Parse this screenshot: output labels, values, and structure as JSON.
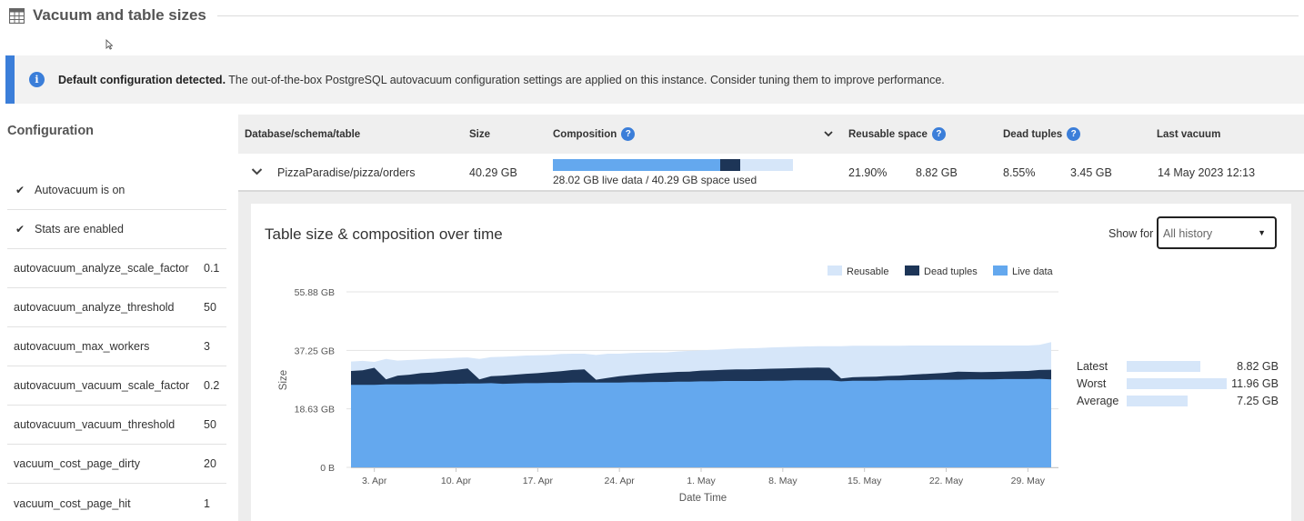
{
  "header": {
    "title": "Vacuum and table sizes",
    "icon": "table-grid-icon"
  },
  "alert": {
    "icon": "info-icon",
    "bold": "Default configuration detected.",
    "text": " The out-of-the-box PostgreSQL autovacuum configuration settings are applied on this instance. Consider tuning them to improve performance."
  },
  "config": {
    "title": "Configuration",
    "checks": [
      {
        "label": "Autovacuum is on",
        "icon": "check-icon"
      },
      {
        "label": "Stats are enabled",
        "icon": "check-icon"
      }
    ],
    "settings": [
      {
        "key": "autovacuum_analyze_scale_factor",
        "value": "0.1"
      },
      {
        "key": "autovacuum_analyze_threshold",
        "value": "50"
      },
      {
        "key": "autovacuum_max_workers",
        "value": "3"
      },
      {
        "key": "autovacuum_vacuum_scale_factor",
        "value": "0.2"
      },
      {
        "key": "autovacuum_vacuum_threshold",
        "value": "50"
      },
      {
        "key": "vacuum_cost_page_dirty",
        "value": "20"
      },
      {
        "key": "vacuum_cost_page_hit",
        "value": "1"
      }
    ]
  },
  "table": {
    "headers": {
      "name": "Database/schema/table",
      "size": "Size",
      "composition": "Composition",
      "reusable": "Reusable space",
      "dead": "Dead tuples",
      "last_vacuum": "Last vacuum"
    },
    "row": {
      "name": "PizzaParadise/pizza/orders",
      "size": "40.29 GB",
      "composition_caption": "28.02 GB live data / 40.29 GB space used",
      "composition_fractions": {
        "live": 0.696,
        "dead": 0.086,
        "reusable": 0.218
      },
      "reusable_pct": "21.90%",
      "reusable_size": "8.82 GB",
      "dead_pct": "8.55%",
      "dead_size": "3.45 GB",
      "last_vacuum": "14 May 2023 12:13"
    }
  },
  "detail": {
    "title": "Table size & composition over time",
    "show_for_label": "Show for",
    "show_for_value": "All history"
  },
  "colors": {
    "live": "#64a8ee",
    "dead": "#1d3557",
    "reusable": "#d6e6f9",
    "accent": "#3b7ed9"
  },
  "chart_data": {
    "type": "area",
    "xlabel": "Date Time",
    "ylabel": "Size",
    "y_ticks": [
      "0 B",
      "18.63 GB",
      "37.25 GB",
      "55.88 GB"
    ],
    "ylim": [
      0,
      55.88
    ],
    "x_ticks": [
      "3. Apr",
      "10. Apr",
      "17. Apr",
      "24. Apr",
      "1. May",
      "8. May",
      "15. May",
      "22. May",
      "29. May"
    ],
    "x_days": [
      1,
      2,
      3,
      4,
      5,
      6,
      7,
      8,
      9,
      10,
      11,
      12,
      13,
      14,
      15,
      16,
      17,
      18,
      19,
      20,
      21,
      22,
      23,
      24,
      25,
      26,
      27,
      28,
      29,
      30,
      31,
      32,
      33,
      34,
      35,
      36,
      37,
      38,
      39,
      40,
      41,
      42,
      43,
      44,
      45,
      46,
      47,
      48,
      49,
      50,
      51,
      52,
      53,
      54,
      55,
      56,
      57,
      58,
      59,
      60,
      61
    ],
    "legend": [
      "Reusable",
      "Dead tuples",
      "Live data"
    ],
    "legend_position": "top-right",
    "series": [
      {
        "name": "Live data",
        "values": [
          26.3,
          26.3,
          26.3,
          26.4,
          26.4,
          26.4,
          26.5,
          26.5,
          26.6,
          26.6,
          26.7,
          26.7,
          26.8,
          26.6,
          26.7,
          26.8,
          26.8,
          26.9,
          26.9,
          27.0,
          27.0,
          27.0,
          27.0,
          27.0,
          27.1,
          27.1,
          27.2,
          27.2,
          27.3,
          27.3,
          27.4,
          27.4,
          27.5,
          27.5,
          27.5,
          27.5,
          27.6,
          27.6,
          27.7,
          27.7,
          27.7,
          27.7,
          27.4,
          27.6,
          27.6,
          27.6,
          27.7,
          27.7,
          27.8,
          27.8,
          27.9,
          27.9,
          27.9,
          28.0,
          28.0,
          28.0,
          28.1,
          28.1,
          28.1,
          28.2,
          28.0
        ]
      },
      {
        "name": "Dead tuples",
        "values": [
          4.4,
          4.6,
          5.4,
          1.6,
          2.8,
          3.1,
          3.5,
          3.7,
          4.0,
          4.4,
          4.8,
          1.3,
          2.2,
          2.6,
          2.8,
          3.0,
          3.2,
          3.4,
          3.7,
          4.0,
          4.2,
          0.9,
          1.5,
          2.0,
          2.3,
          2.6,
          2.8,
          3.0,
          3.1,
          3.2,
          3.4,
          3.5,
          3.6,
          3.7,
          3.7,
          3.8,
          3.8,
          3.9,
          3.9,
          4.0,
          4.1,
          4.0,
          0.9,
          1.1,
          1.2,
          1.3,
          1.4,
          1.5,
          1.7,
          1.9,
          2.0,
          2.2,
          2.6,
          2.4,
          2.3,
          2.4,
          2.4,
          2.5,
          2.6,
          2.8,
          3.1
        ]
      },
      {
        "name": "Reusable",
        "values": [
          3.0,
          3.0,
          1.9,
          6.5,
          4.8,
          4.7,
          4.4,
          4.4,
          4.1,
          3.9,
          3.5,
          6.5,
          6.1,
          6.0,
          5.9,
          5.8,
          5.7,
          5.5,
          5.5,
          5.2,
          5.0,
          7.9,
          7.7,
          7.2,
          7.0,
          6.8,
          6.6,
          6.4,
          6.5,
          6.6,
          6.5,
          6.5,
          6.5,
          6.6,
          6.7,
          6.7,
          6.8,
          6.8,
          6.8,
          6.8,
          6.8,
          6.9,
          10.3,
          10.0,
          9.9,
          9.8,
          9.6,
          9.5,
          9.3,
          9.1,
          8.9,
          8.7,
          8.3,
          8.4,
          8.5,
          8.4,
          8.3,
          8.2,
          8.1,
          8.0,
          8.8
        ]
      }
    ],
    "stats": [
      {
        "label": "Latest",
        "value": "8.82 GB",
        "amount": 8.82
      },
      {
        "label": "Worst",
        "value": "11.96 GB",
        "amount": 11.96
      },
      {
        "label": "Average",
        "value": "7.25 GB",
        "amount": 7.25
      }
    ]
  }
}
